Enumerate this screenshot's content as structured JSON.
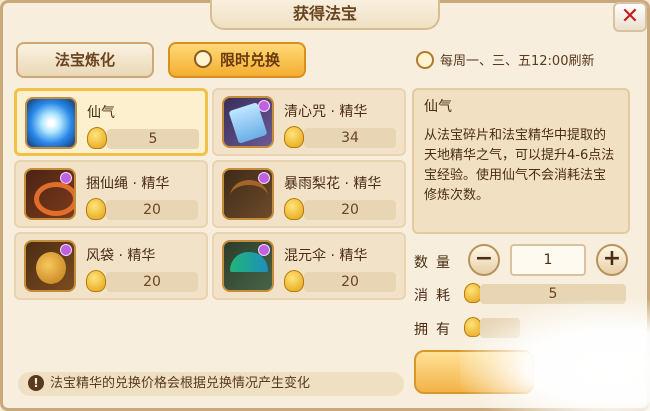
{
  "window": {
    "title": "获得法宝"
  },
  "tabs": [
    {
      "label": "法宝炼化"
    },
    {
      "label": "限时兑换"
    }
  ],
  "refresh_text": "每周一、三、五12:00刷新",
  "items": [
    {
      "name": "仙气",
      "price": "5",
      "icon": "qi-orb-icon",
      "selected": true
    },
    {
      "name": "清心咒 · 精华",
      "price": "34",
      "icon": "scroll-icon"
    },
    {
      "name": "捆仙绳 · 精华",
      "price": "20",
      "icon": "rope-icon"
    },
    {
      "name": "暴雨梨花 · 精华",
      "price": "20",
      "icon": "crossbow-icon"
    },
    {
      "name": "风袋 · 精华",
      "price": "20",
      "icon": "wind-bag-icon"
    },
    {
      "name": "混元伞 · 精华",
      "price": "20",
      "icon": "umbrella-icon"
    }
  ],
  "detail": {
    "title": "仙气",
    "description": "从法宝碎片和法宝精华中提取的天地精华之气，可以提升4-6点法宝经验。使用仙气不会消耗法宝修炼次数。"
  },
  "purchase": {
    "quantity_label": "数量",
    "quantity": "1",
    "cost_label": "消耗",
    "cost": "5",
    "own_label": "拥有"
  },
  "notice": "法宝精华的兑换价格会根据兑换情况产生变化",
  "colors": {
    "accent": "#f4ae31",
    "close": "#c81c1c"
  }
}
